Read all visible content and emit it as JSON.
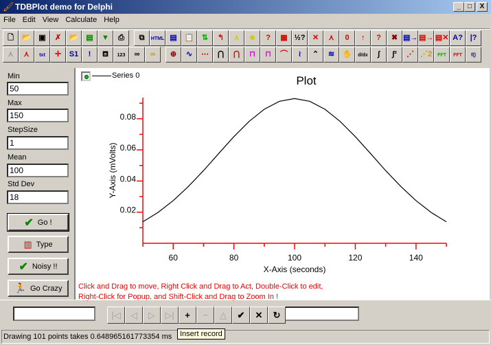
{
  "window": {
    "title": "TDBPlot demo for Delphi",
    "minimize": "_",
    "maximize": "□",
    "close": "X"
  },
  "menu": [
    "File",
    "Edit",
    "View",
    "Calculate",
    "Help"
  ],
  "toolbar1": {
    "group1": [
      {
        "icon": "new-icon",
        "g": "🗋",
        "c": "#000"
      },
      {
        "icon": "open-icon",
        "g": "📂",
        "c": "#880"
      },
      {
        "icon": "save-all-icon",
        "g": "▣",
        "c": "#000"
      },
      {
        "icon": "delete-file-icon",
        "g": "✗",
        "c": "#d00"
      },
      {
        "icon": "open-folder-icon",
        "g": "📂",
        "c": "#880"
      },
      {
        "icon": "save-icon",
        "g": "▤",
        "c": "#080"
      },
      {
        "icon": "export-image-icon",
        "g": "▼",
        "c": "#080"
      },
      {
        "icon": "print-icon",
        "g": "⎙",
        "c": "#000"
      }
    ],
    "group2": [
      {
        "icon": "copy-icon",
        "g": "⧉",
        "c": "#000"
      },
      {
        "icon": "html-icon",
        "g": "HTML",
        "c": "#00a"
      },
      {
        "icon": "document-icon",
        "g": "▤",
        "c": "#00a"
      },
      {
        "icon": "paste-icon",
        "g": "📋",
        "c": "#00a"
      },
      {
        "icon": "swap-arrows-icon",
        "g": "⇅",
        "c": "#0a0"
      },
      {
        "icon": "red-arrow-icon",
        "g": "↰",
        "c": "#d00"
      },
      {
        "icon": "peak-highlight-icon",
        "g": "⋏",
        "c": "#cc0"
      },
      {
        "icon": "people-icon",
        "g": "☻",
        "c": "#cc0"
      },
      {
        "icon": "question-icon",
        "g": "?",
        "c": "#d00"
      },
      {
        "icon": "data-grid-icon",
        "g": "▦",
        "c": "#d00"
      },
      {
        "icon": "fraction-help-icon",
        "g": "½?",
        "c": "#000"
      },
      {
        "icon": "delete-red-icon",
        "g": "✕",
        "c": "#d00"
      },
      {
        "icon": "delete-peak-icon",
        "g": "⋏",
        "c": "#d00"
      },
      {
        "icon": "zero-icon",
        "g": "0",
        "c": "#d00"
      },
      {
        "icon": "flash-icon",
        "g": "↑",
        "c": "#d00"
      },
      {
        "icon": "red-question-icon",
        "g": "?",
        "c": "#d00"
      },
      {
        "icon": "delete-dark-icon",
        "g": "✖",
        "c": "#800"
      },
      {
        "icon": "list-arrow-blue-icon",
        "g": "▤→",
        "c": "#00a"
      },
      {
        "icon": "list-arrow-red-icon",
        "g": "▤→",
        "c": "#d00"
      },
      {
        "icon": "list-delete-icon",
        "g": "▤✕",
        "c": "#d00"
      },
      {
        "icon": "font-help-icon",
        "g": "A?",
        "c": "#00a"
      },
      {
        "icon": "axis-help-icon",
        "g": "|?",
        "c": "#00a"
      }
    ]
  },
  "toolbar2": {
    "group1": [
      {
        "icon": "peak-disabled-icon",
        "g": "⋏",
        "c": "#999"
      },
      {
        "icon": "peak-axis-icon",
        "g": "⋏",
        "c": "#d00"
      },
      {
        "icon": "text-icon",
        "g": "txt",
        "c": "#00a"
      },
      {
        "icon": "crosshair-icon",
        "g": "✛",
        "c": "#d00"
      },
      {
        "icon": "s1-t2-icon",
        "g": "S1",
        "c": "#00a"
      },
      {
        "icon": "axis-alert-icon",
        "g": "!",
        "c": "#00a"
      },
      {
        "icon": "binoculars-axis-icon",
        "g": "⛾",
        "c": "#000"
      },
      {
        "icon": "binoculars-numbers-icon",
        "g": "123",
        "c": "#000"
      },
      {
        "icon": "binoculars-icon",
        "g": "∞",
        "c": "#000"
      },
      {
        "icon": "binoculars-yellow-icon",
        "g": "∞",
        "c": "#c90"
      }
    ],
    "group2": [
      {
        "icon": "target-icon",
        "g": "⊕",
        "c": "#800"
      },
      {
        "icon": "curve-icon",
        "g": "∿",
        "c": "#00a"
      },
      {
        "icon": "dotted-axis-icon",
        "g": "⋯",
        "c": "#d00"
      },
      {
        "icon": "peak-fit-icon",
        "g": "⋂",
        "c": "#000"
      },
      {
        "icon": "peak-fit-red-icon",
        "g": "⋂",
        "c": "#d00"
      },
      {
        "icon": "peak-box-magenta-icon",
        "g": "⊓",
        "c": "#d0d"
      },
      {
        "icon": "peak-box-icon",
        "g": "⊓",
        "c": "#d0d"
      },
      {
        "icon": "line-points-icon",
        "g": "⌒",
        "c": "#d00"
      },
      {
        "icon": "noise-icon",
        "g": "≀",
        "c": "#00a"
      },
      {
        "icon": "small-peak-icon",
        "g": "⌃",
        "c": "#000"
      },
      {
        "icon": "spectrum-icon",
        "g": "≋",
        "c": "#00a"
      },
      {
        "icon": "hand-icon",
        "g": "✋",
        "c": "#c90"
      },
      {
        "icon": "derivative-icon",
        "g": "d/dx",
        "c": "#000"
      },
      {
        "icon": "integral-icon",
        "g": "∫",
        "c": "#000"
      },
      {
        "icon": "integral-squared-icon",
        "g": "∫²",
        "c": "#000"
      },
      {
        "icon": "line-fit-icon",
        "g": "⋰",
        "c": "#d00"
      },
      {
        "icon": "fit-2-icon",
        "g": "⋰2",
        "c": "#c90"
      },
      {
        "icon": "fft-green-icon",
        "g": "FFT",
        "c": "#0a0"
      },
      {
        "icon": "fft-red-icon",
        "g": "FFT",
        "c": "#d00"
      },
      {
        "icon": "function-icon",
        "g": "f()",
        "c": "#00a"
      }
    ]
  },
  "params": [
    {
      "label": "Min",
      "value": "50"
    },
    {
      "label": "Max",
      "value": "150"
    },
    {
      "label": "StepSize",
      "value": "1"
    },
    {
      "label": "Mean",
      "value": "100"
    },
    {
      "label": "Std Dev",
      "value": "18"
    }
  ],
  "buttons": {
    "go": "Go !",
    "type": "Type",
    "noisy": "Noisy !!",
    "crazy": "Go Crazy"
  },
  "legend": {
    "series": "Series 0",
    "marker_color": "#00cc00"
  },
  "message": [
    "Click and Drag to move, Right Click and Drag to Act, Double-Click to edit,",
    "Right-Click for Popup, and Shift-Click and Drag to Zoom In !"
  ],
  "navigator": {
    "buttons": [
      {
        "icon": "first-record-icon",
        "g": "|◁",
        "enabled": false
      },
      {
        "icon": "prior-record-icon",
        "g": "◁",
        "enabled": false
      },
      {
        "icon": "next-record-icon",
        "g": "▷",
        "enabled": false
      },
      {
        "icon": "last-record-icon",
        "g": "▷|",
        "enabled": false
      },
      {
        "icon": "insert-record-icon",
        "g": "+",
        "enabled": true
      },
      {
        "icon": "delete-record-icon",
        "g": "−",
        "enabled": false
      },
      {
        "icon": "edit-record-icon",
        "g": "△",
        "enabled": false
      },
      {
        "icon": "post-record-icon",
        "g": "✔",
        "enabled": true
      },
      {
        "icon": "cancel-record-icon",
        "g": "✕",
        "enabled": true
      },
      {
        "icon": "refresh-record-icon",
        "g": "↻",
        "enabled": true
      }
    ],
    "tooltip": "Insert record",
    "left_value": "",
    "right_value": ""
  },
  "status": "Drawing 101 points takes 0.648965161773354 ms",
  "chart_data": {
    "type": "line",
    "title": "Plot",
    "xlabel": "X-Axis (seconds)",
    "ylabel": "Y-Axis (mVolts)",
    "xlim": [
      50,
      150
    ],
    "ylim": [
      0,
      0.0936
    ],
    "x_ticks": [
      60,
      80,
      100,
      120,
      140
    ],
    "y_ticks": [
      0.02,
      0.04,
      0.06,
      0.08
    ],
    "y_tick_labels": [
      "0.02",
      "0.04",
      "0.06",
      "0.08"
    ],
    "axis_color": "#ff0000",
    "grid": false,
    "legend": "top-left",
    "series": [
      {
        "name": "Series 0",
        "color": "#000000",
        "x": [
          50,
          55,
          60,
          65,
          70,
          75,
          80,
          85,
          90,
          95,
          100,
          105,
          110,
          115,
          120,
          125,
          130,
          135,
          140,
          145,
          150
        ],
        "y": [
          0.0138,
          0.0198,
          0.0274,
          0.0365,
          0.0467,
          0.0577,
          0.0685,
          0.0783,
          0.0861,
          0.0912,
          0.093,
          0.0912,
          0.0861,
          0.0783,
          0.0685,
          0.0577,
          0.0467,
          0.0365,
          0.0274,
          0.0198,
          0.0138
        ]
      }
    ]
  }
}
